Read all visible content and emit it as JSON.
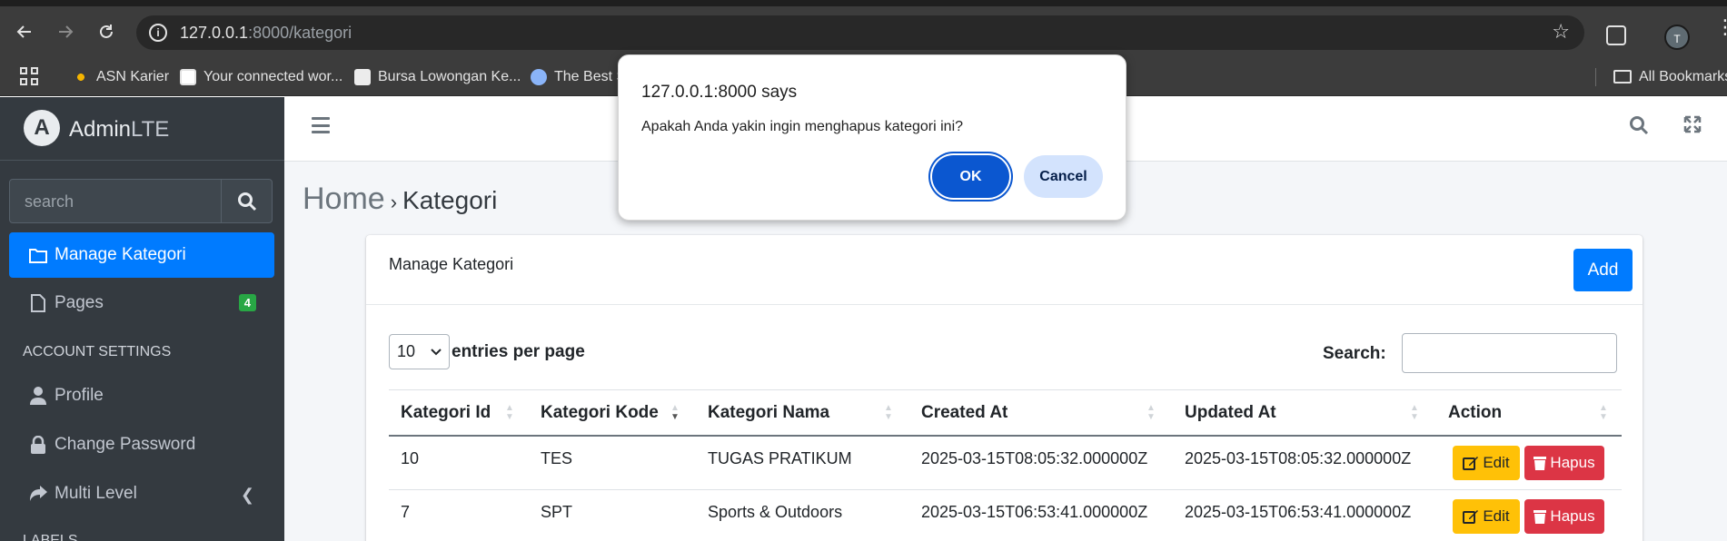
{
  "browser": {
    "url_host": "127.0.0.1",
    "url_rest": ":8000/kategori",
    "profile_initial": "T",
    "bookmarks": [
      {
        "label": "ASN Karier"
      },
      {
        "label": "Your connected wor..."
      },
      {
        "label": "Bursa Lowongan Ke..."
      },
      {
        "label": "The Best S"
      }
    ],
    "all_bookmarks_label": "All Bookmarks"
  },
  "sidebar": {
    "brand_bold": "Admin",
    "brand_light": "LTE",
    "brand_logo": "A",
    "search_placeholder": "search",
    "items": [
      {
        "label": "Manage Kategori",
        "icon": "folder-icon"
      },
      {
        "label": "Pages",
        "icon": "file-icon",
        "badge": "4"
      }
    ],
    "section_header": "ACCOUNT SETTINGS",
    "account_items": [
      {
        "label": "Profile",
        "icon": "user-icon"
      },
      {
        "label": "Change Password",
        "icon": "lock-icon"
      },
      {
        "label": "Multi Level",
        "icon": "share-icon"
      }
    ],
    "labels_header": "LABELS"
  },
  "breadcrumb": {
    "home": "Home",
    "current": "Kategori"
  },
  "card": {
    "title": "Manage Kategori",
    "add_label": "Add",
    "entries_value": "10",
    "entries_label": "entries per page",
    "search_label": "Search:"
  },
  "table": {
    "headers": [
      "Kategori Id",
      "Kategori Kode",
      "Kategori Nama",
      "Created At",
      "Updated At",
      "Action"
    ],
    "rows": [
      {
        "id": "10",
        "kode": "TES",
        "nama": "TUGAS PRATIKUM",
        "created": "2025-03-15T08:05:32.000000Z",
        "updated": "2025-03-15T08:05:32.000000Z"
      },
      {
        "id": "7",
        "kode": "SPT",
        "nama": "Sports & Outdoors",
        "created": "2025-03-15T06:53:41.000000Z",
        "updated": "2025-03-15T06:53:41.000000Z"
      }
    ],
    "edit_label": "Edit",
    "delete_label": "Hapus"
  },
  "dialog": {
    "title": "127.0.0.1:8000 says",
    "message": "Apakah Anda yakin ingin menghapus kategori ini?",
    "ok_label": "OK",
    "cancel_label": "Cancel"
  },
  "colors": {
    "primary": "#007bff",
    "sidebar": "#343a40",
    "warning": "#ffc107",
    "danger": "#dc3545",
    "success": "#28a745"
  }
}
